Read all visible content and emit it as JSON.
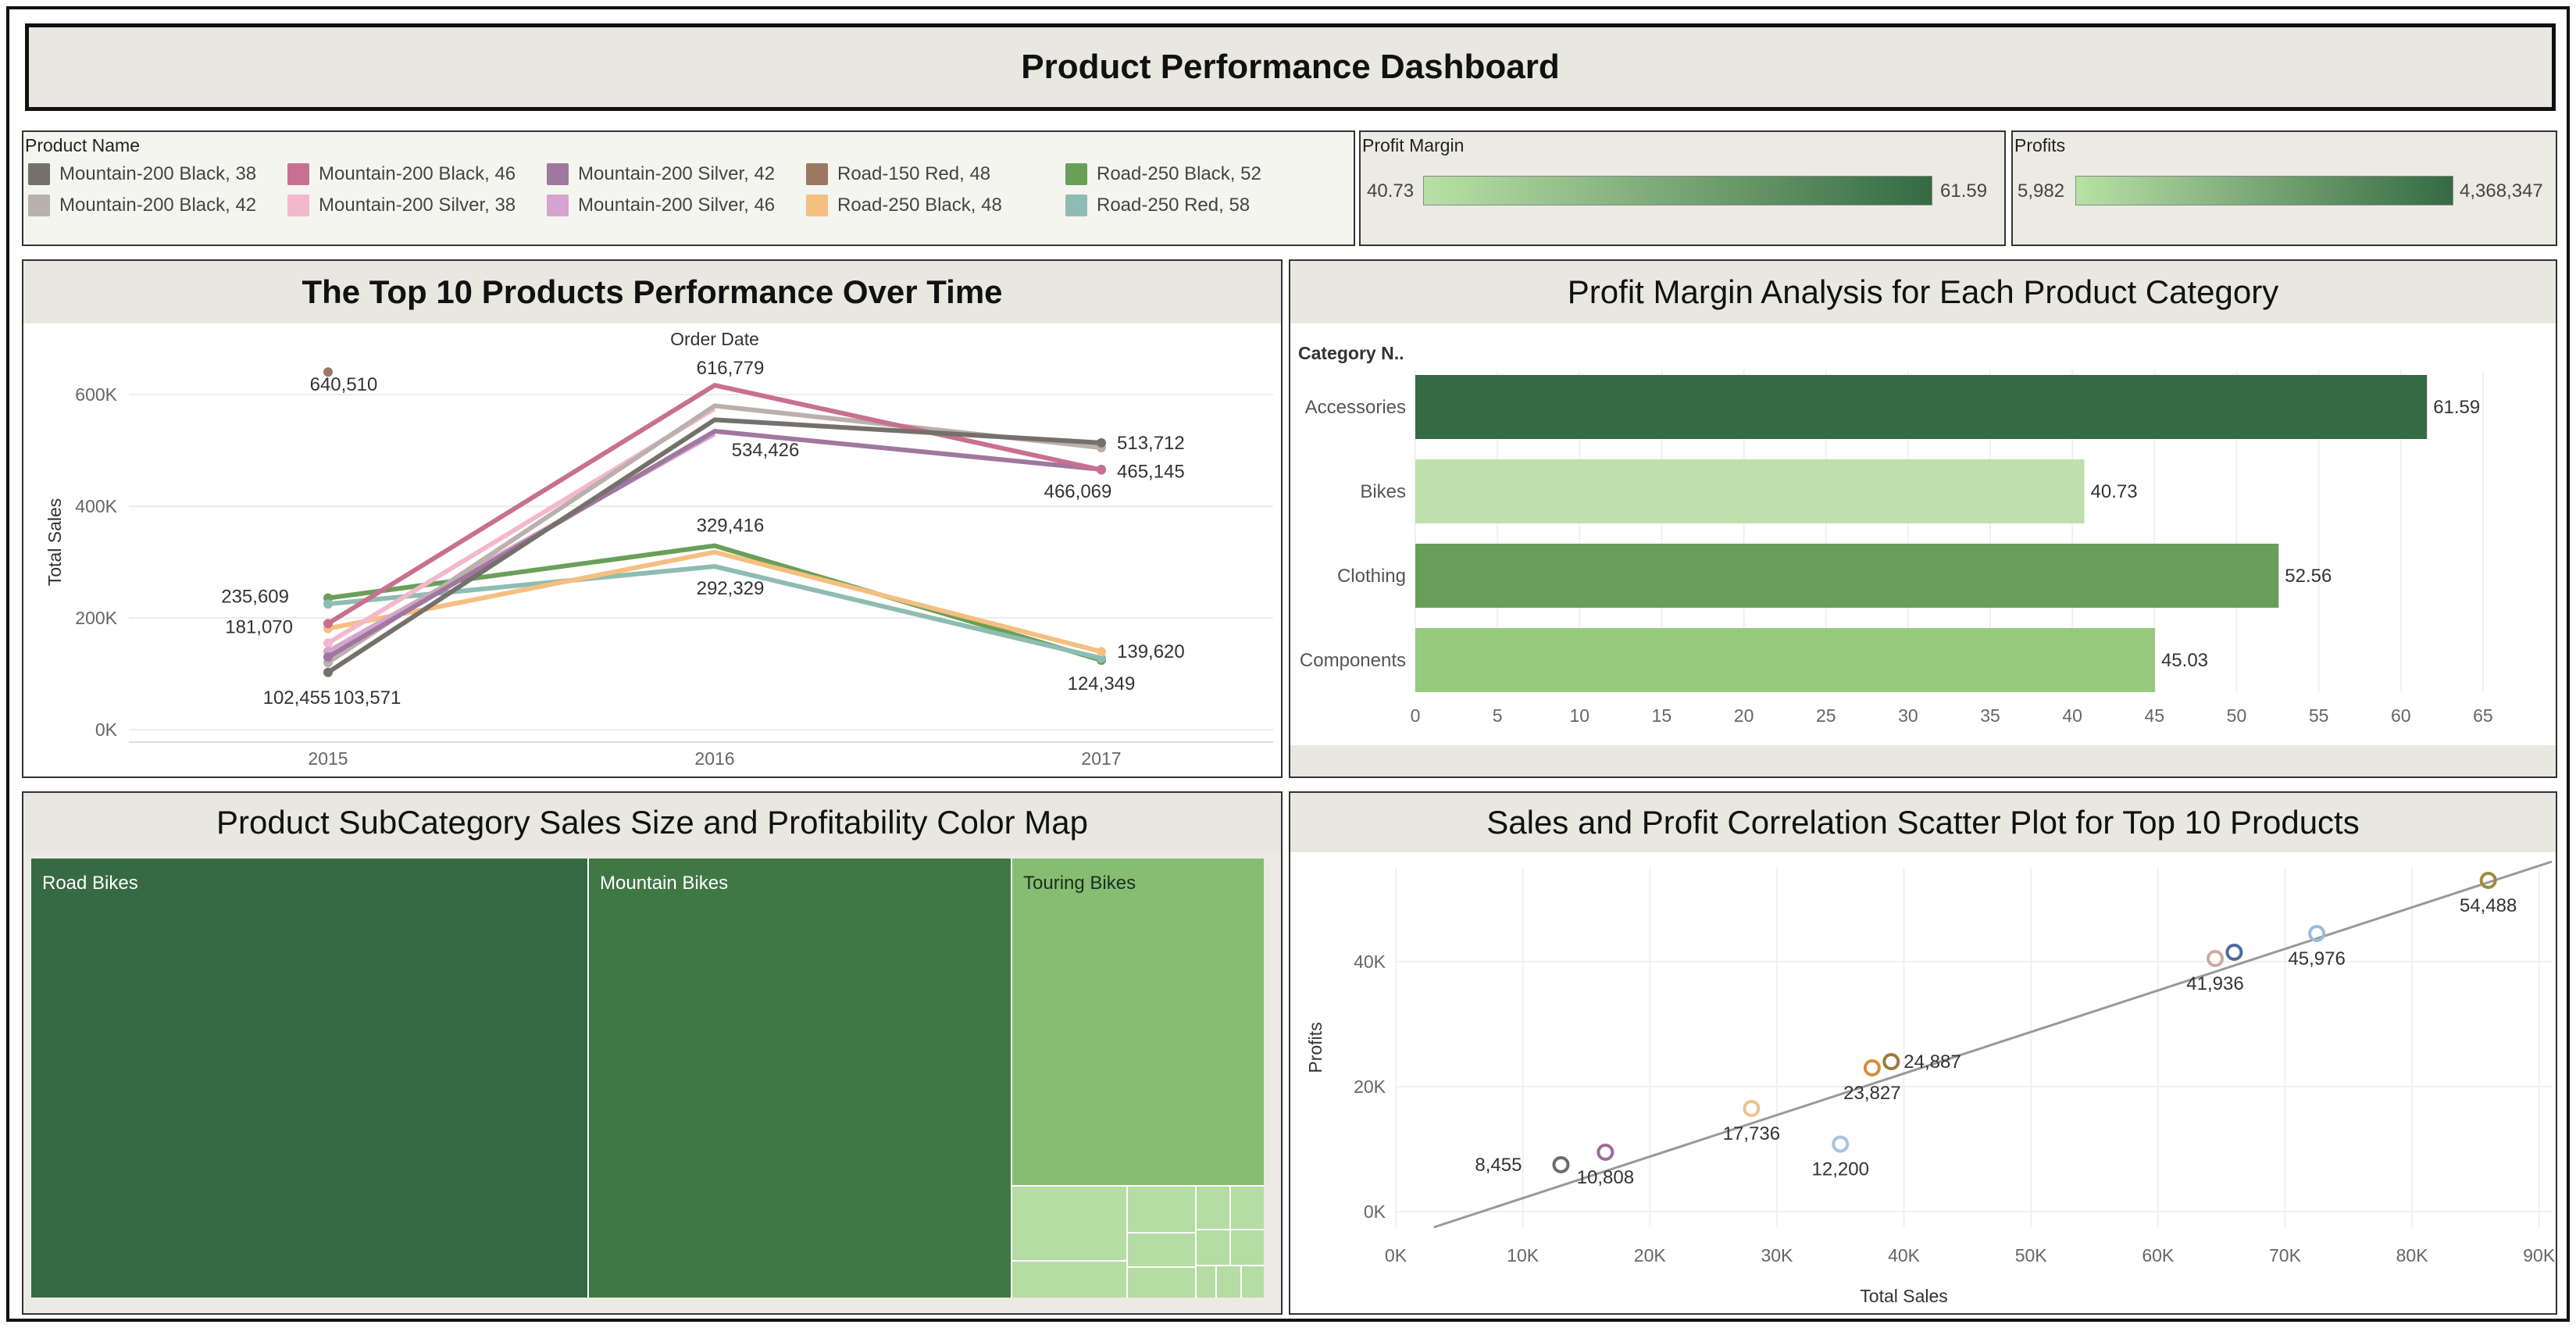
{
  "header": {
    "title": "Product Performance Dashboard"
  },
  "legend": {
    "title": "Product Name",
    "items": [
      {
        "label": "Mountain-200 Black, 38",
        "color": "#76706c"
      },
      {
        "label": "Mountain-200 Black, 42",
        "color": "#bab0ac"
      },
      {
        "label": "Mountain-200 Black, 46",
        "color": "#c87090"
      },
      {
        "label": "Mountain-200 Silver, 38",
        "color": "#f4b8cd"
      },
      {
        "label": "Mountain-200 Silver, 42",
        "color": "#a0779f"
      },
      {
        "label": "Mountain-200 Silver, 46",
        "color": "#d5a4d0"
      },
      {
        "label": "Road-150 Red, 48",
        "color": "#9c7762"
      },
      {
        "label": "Road-250 Black, 48",
        "color": "#f5bf80"
      },
      {
        "label": "Road-250 Black, 52",
        "color": "#6a9f58"
      },
      {
        "label": "Road-250 Red, 58",
        "color": "#8fbcb2"
      }
    ]
  },
  "profit_margin_card": {
    "title": "Profit Margin",
    "min": "40.73",
    "max": "61.59"
  },
  "profits_card": {
    "title": "Profits",
    "min": "5,982",
    "max": "4,368,347"
  },
  "colors": {
    "ramp_low": "#b9e1a6",
    "ramp_high": "#366a43"
  },
  "panels": {
    "line": "The Top 10 Products Performance Over Time",
    "bar": "Profit Margin Analysis for Each Product Category",
    "treemap": "Product SubCategory Sales Size and Profitability Color Map",
    "scatter": "Sales and Profit Correlation Scatter Plot for Top 10 Products"
  },
  "treemap": {
    "labels": [
      "Road Bikes",
      "Mountain Bikes",
      "Touring Bikes"
    ]
  },
  "chart_data": [
    {
      "type": "line",
      "title": "The Top 10 Products Performance Over Time",
      "xlabel": "Order Date",
      "ylabel": "Total Sales",
      "categories": [
        "2015",
        "2016",
        "2017"
      ],
      "yticks": [
        "0K",
        "200K",
        "400K",
        "600K"
      ],
      "ylim": [
        0,
        680000
      ],
      "grid": true,
      "series": [
        {
          "name": "Road-250 Black, 52",
          "color": "#6a9f58",
          "values": [
            235609,
            329416,
            124349
          ]
        },
        {
          "name": "Road-250 Red, 58",
          "color": "#8fbcb2",
          "values": [
            225000,
            292329,
            128000
          ]
        },
        {
          "name": "Road-250 Black, 48",
          "color": "#f5bf80",
          "values": [
            181070,
            318000,
            139620
          ]
        },
        {
          "name": "Mountain-200 Silver, 38",
          "color": "#f4b8cd",
          "values": [
            155000,
            575000,
            null
          ]
        },
        {
          "name": "Mountain-200 Silver, 46",
          "color": "#d5a4d0",
          "values": [
            140000,
            530000,
            null
          ]
        },
        {
          "name": "Mountain-200 Black, 42",
          "color": "#bab0ac",
          "values": [
            120000,
            580000,
            505000
          ]
        },
        {
          "name": "Mountain-200 Silver, 42",
          "color": "#a0779f",
          "values": [
            130000,
            534426,
            466069
          ]
        },
        {
          "name": "Mountain-200 Black, 46",
          "color": "#c87090",
          "values": [
            190000,
            616779,
            465145
          ]
        },
        {
          "name": "Mountain-200 Black, 38",
          "color": "#76706c",
          "values": [
            102455,
            555000,
            513712
          ]
        },
        {
          "name": "Road-150 Red, 48",
          "color": "#9c7762",
          "values": [
            640510,
            null,
            null
          ]
        }
      ],
      "data_labels": [
        "640,510",
        "616,779",
        "534,426",
        "513,712",
        "465,145",
        "466,069",
        "329,416",
        "292,329",
        "235,609",
        "181,070",
        "102,455",
        "103,571",
        "139,620",
        "124,349"
      ]
    },
    {
      "type": "bar",
      "title": "Profit Margin Analysis for Each Product Category",
      "ylabel": "Category N..",
      "categories": [
        "Accessories",
        "Bikes",
        "Clothing",
        "Components"
      ],
      "values": [
        61.59,
        40.73,
        52.56,
        45.03
      ],
      "value_labels": [
        "61.59",
        "40.73",
        "52.56",
        "45.03"
      ],
      "colors": [
        "#366a43",
        "#bde0ac",
        "#699e5a",
        "#97c97f"
      ],
      "xticks": [
        "0",
        "5",
        "10",
        "15",
        "20",
        "25",
        "30",
        "35",
        "40",
        "45",
        "50",
        "55",
        "60",
        "65"
      ],
      "xlim": [
        0,
        68
      ]
    },
    {
      "type": "heatmap",
      "title": "Product SubCategory Sales Size and Profitability Color Map",
      "categories": [
        "Road Bikes",
        "Mountain Bikes",
        "Touring Bikes"
      ],
      "colors": [
        "#366a43",
        "#3f7745",
        "#87bd73"
      ]
    },
    {
      "type": "scatter",
      "title": "Sales and Profit Correlation Scatter Plot for Top 10 Products",
      "xlabel": "Total Sales",
      "ylabel": "Profits",
      "xticks": [
        "0K",
        "10K",
        "20K",
        "30K",
        "40K",
        "50K",
        "60K",
        "70K",
        "80K",
        "90K"
      ],
      "yticks": [
        "0K",
        "20K",
        "40K"
      ],
      "xlim": [
        0,
        91000
      ],
      "ylim": [
        -2500,
        55000
      ],
      "points": [
        {
          "x": 13000,
          "y": 7500,
          "label": "8,455",
          "color": "#6f6a67"
        },
        {
          "x": 16500,
          "y": 9500,
          "label": "10,808",
          "color": "#9c6b9b"
        },
        {
          "x": 28000,
          "y": 16500,
          "label": "17,736",
          "color": "#f1c18f"
        },
        {
          "x": 35000,
          "y": 10800,
          "label": "12,200",
          "color": "#a9c3df"
        },
        {
          "x": 37500,
          "y": 23000,
          "label": "23,827",
          "color": "#d98b3a"
        },
        {
          "x": 39000,
          "y": 24000,
          "label": "24,887",
          "color": "#9a7a3a"
        },
        {
          "x": 64500,
          "y": 40500,
          "label": "41,936",
          "color": "#d2a8a0"
        },
        {
          "x": 66000,
          "y": 41500,
          "label": "",
          "color": "#4a6aa0"
        },
        {
          "x": 72500,
          "y": 44500,
          "label": "45,976",
          "color": "#9bbbe0"
        },
        {
          "x": 86000,
          "y": 53000,
          "label": "54,488",
          "color": "#a08a3a"
        }
      ],
      "trend": [
        [
          3000,
          -2500
        ],
        [
          91000,
          56000
        ]
      ]
    }
  ]
}
